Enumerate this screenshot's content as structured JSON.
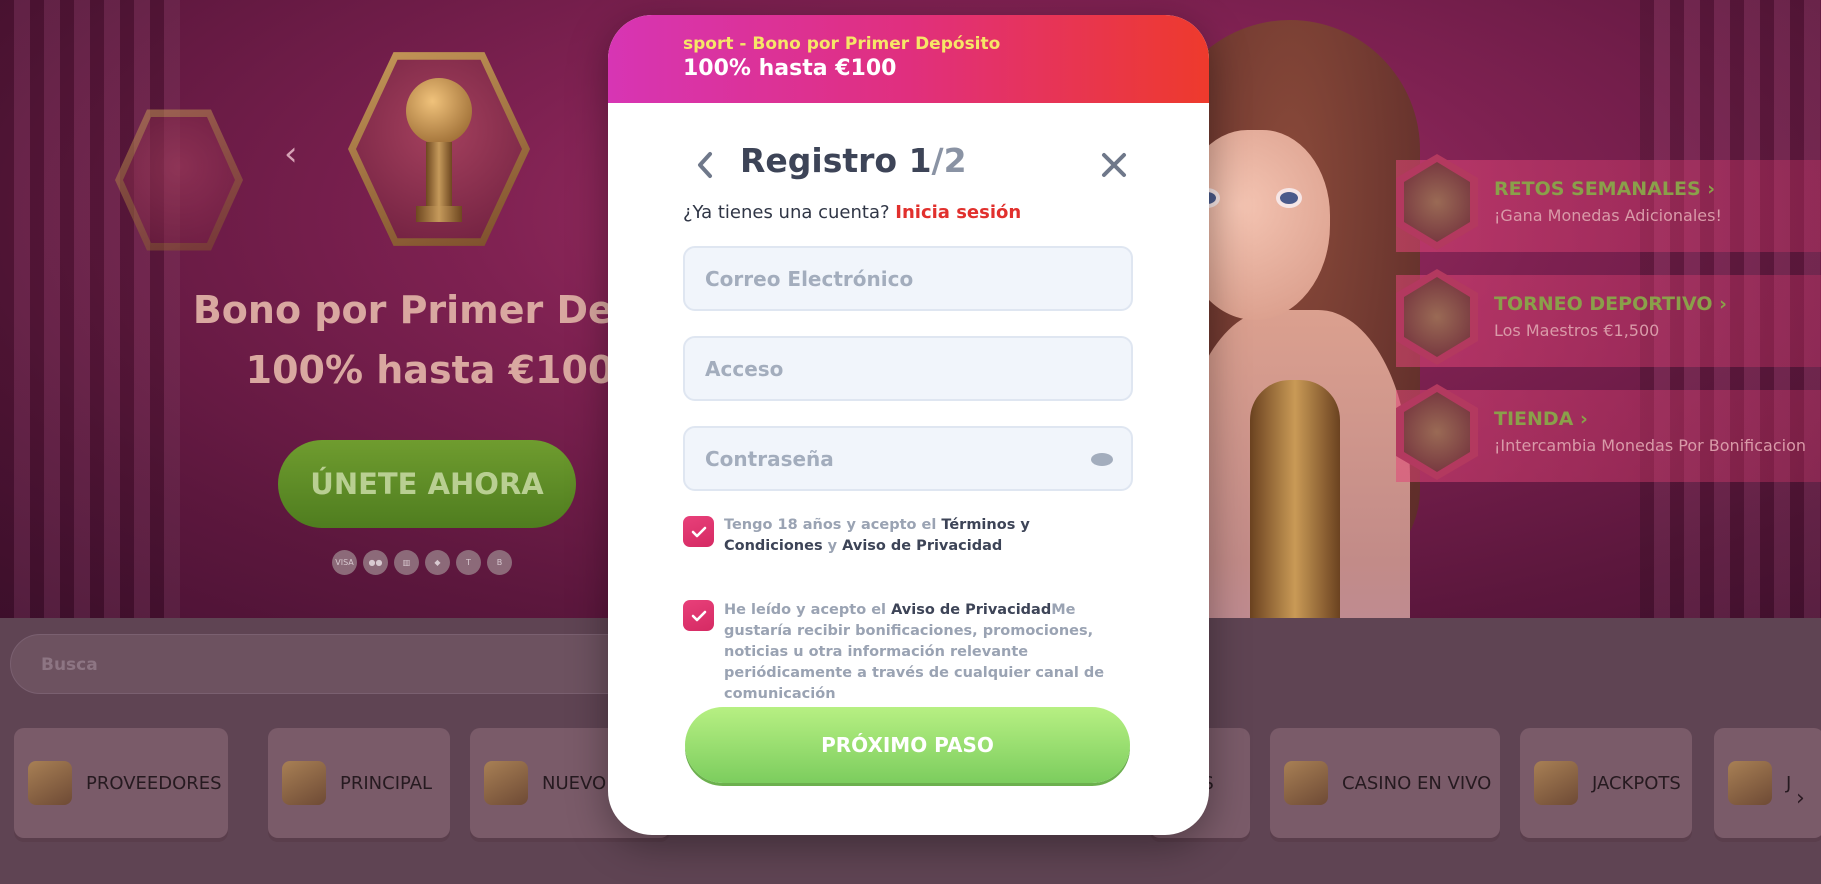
{
  "modal": {
    "header": {
      "bonus_label": "sport - Bono por Primer Depósito",
      "bonus_amount": "100% hasta €100"
    },
    "title": "Registro 1",
    "step": "/2",
    "account_question": "¿Ya tienes una cuenta?",
    "login_link": "Inicia sesión",
    "fields": {
      "email_placeholder": "Correo Electrónico",
      "login_placeholder": "Acceso",
      "password_placeholder": "Contraseña"
    },
    "consent_terms": {
      "prefix": "Tengo 18 años y acepto el ",
      "terms_link": "Términos y Condiciones",
      "middle": " y ",
      "privacy_link": "Aviso de Privacidad",
      "checked": true
    },
    "consent_marketing": {
      "prefix": "He leído y acepto el ",
      "privacy_link": "Aviso de Privacidad",
      "suffix": "Me gustaría recibir bonificaciones, promociones, noticias u otra información relevante periódicamente a través de cualquier canal de comunicación",
      "checked": true
    },
    "next_button": "PRÓXIMO PASO",
    "colors": {
      "header_gradient": [
        "#d735b4",
        "#e02f7e",
        "#ee3a2c"
      ],
      "bonus_label": "#f6e667",
      "link": "#e1302d",
      "checkbox": "#e8407a",
      "next_button": "#7ccd5e"
    }
  },
  "hero": {
    "title": "Bono por Primer Depó",
    "subtitle": "100% hasta €100",
    "join_button": "ÚNETE AHORA",
    "payment_icons": [
      "visa-icon",
      "mastercard-icon",
      "bank-icon",
      "ethereum-icon",
      "tether-icon",
      "bitcoin-icon"
    ],
    "payment_labels": [
      "VISA",
      "",
      "",
      "",
      "T",
      "B"
    ]
  },
  "promos": [
    {
      "title": "RETOS SEMANALES",
      "subtitle": "¡Gana Monedas Adicionales!",
      "icon": "star-trophy-icon"
    },
    {
      "title": "TORNEO DEPORTIVO",
      "subtitle": "Los Maestros €1,500",
      "icon": "cup-icon"
    },
    {
      "title": "TIENDA",
      "subtitle": "¡Intercambia Monedas Por Bonificacion",
      "icon": "shop-icon"
    }
  ],
  "search": {
    "placeholder": "Busca"
  },
  "categories": [
    {
      "label": "PROVEEDORES",
      "icon": "providers-icon"
    },
    {
      "label": "PRINCIPAL",
      "icon": "main-icon"
    },
    {
      "label": "NUEVO",
      "icon": "new-icon"
    },
    {
      "label": "AS",
      "icon": "category-icon"
    },
    {
      "label": "CASINO EN VIVO",
      "icon": "live-casino-icon"
    },
    {
      "label": "JACKPOTS",
      "icon": "jackpots-icon"
    },
    {
      "label": "J",
      "icon": "cards-icon"
    }
  ]
}
